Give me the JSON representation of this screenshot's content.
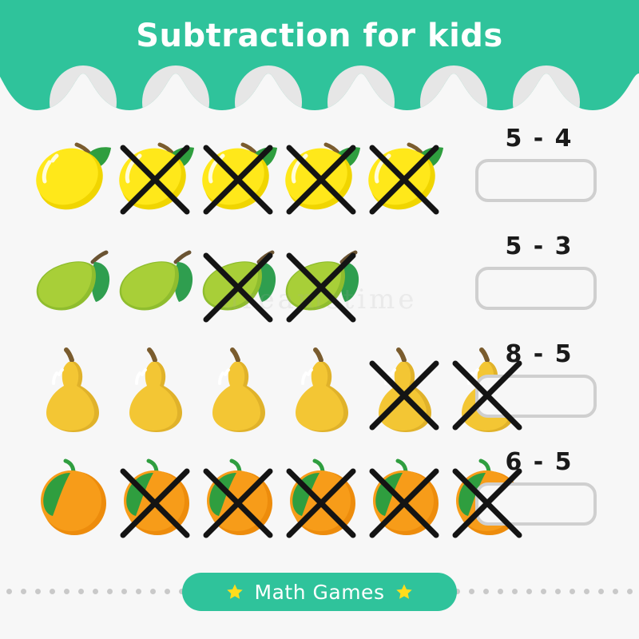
{
  "header": {
    "title": "Subtraction for kids",
    "background_color": "#2fc39b",
    "scallop_color": "#e6e6e6",
    "title_color": "#ffffff"
  },
  "page": {
    "background_color": "#f7f7f7",
    "watermark_text": "dreamstime"
  },
  "rows": [
    {
      "fruit": "lemon",
      "total": 5,
      "crossed": 4,
      "crossed_from_index": 1,
      "equation": "5 - 4",
      "minuend": 5,
      "subtrahend": 4,
      "answer": "",
      "colors": {
        "body": "#ffe81a",
        "shade": "#f0d500",
        "leaf": "#2f9e3f",
        "stem": "#7a5c2e"
      }
    },
    {
      "fruit": "mango",
      "total": 4,
      "crossed": 2,
      "crossed_from_index": 2,
      "equation": "5 - 3",
      "minuend": 5,
      "subtrahend": 3,
      "answer": "",
      "colors": {
        "body": "#a8cf38",
        "shade": "#8fbd2e",
        "leaf": "#2f9e4f",
        "stem": "#6b5433"
      }
    },
    {
      "fruit": "pear",
      "total": 6,
      "crossed": 2,
      "crossed_from_index": 4,
      "equation": "8 - 5",
      "minuend": 8,
      "subtrahend": 5,
      "answer": "",
      "colors": {
        "body": "#f3c634",
        "shade": "#e0b22a",
        "leaf": "#2f9e3f",
        "stem": "#7a5c2e"
      }
    },
    {
      "fruit": "orange",
      "total": 6,
      "crossed": 5,
      "crossed_from_index": 1,
      "equation": "6 - 5",
      "minuend": 6,
      "subtrahend": 5,
      "answer": "",
      "colors": {
        "body": "#f79c19",
        "shade": "#ed8c0c",
        "leaf": "#2f9e3f",
        "stem": "#2f9e3f"
      }
    }
  ],
  "cross_mark": {
    "color": "#141414",
    "stroke_width": 7
  },
  "footer": {
    "button_label": "Math Games",
    "button_color": "#2fc39b",
    "star_color": "#ffdd1c",
    "dot_color": "#c9c9c9",
    "left_dots": 17,
    "right_dots": 17
  }
}
